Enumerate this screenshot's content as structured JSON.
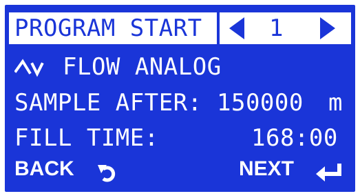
{
  "header": {
    "title": "PROGRAM START",
    "program_number": "1",
    "prev_icon": "arrow-left-icon",
    "next_icon": "arrow-right-icon"
  },
  "mode": {
    "icon": "analog-wave-icon",
    "label": "FLOW ANALOG"
  },
  "sample_after": {
    "label": "SAMPLE AFTER:",
    "value": "150000",
    "unit": "m"
  },
  "fill_time": {
    "label": "FILL TIME:",
    "value": "168:00"
  },
  "footer": {
    "back_label": "BACK",
    "back_icon": "return-arrow-icon",
    "next_label": "NEXT",
    "next_icon": "enter-arrow-icon"
  },
  "colors": {
    "screen": "#1a35d8",
    "text": "#ffffff"
  }
}
